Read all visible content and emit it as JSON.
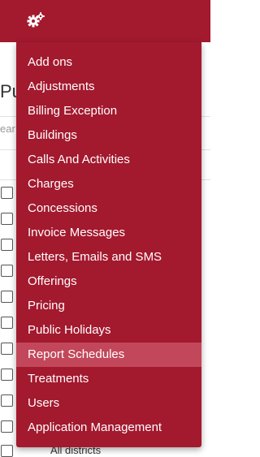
{
  "header": {
    "icon": "gears-icon",
    "background": "#a3192e"
  },
  "background_page": {
    "title": "Pu",
    "search_placeholder": "ear",
    "footer_text": "All districts"
  },
  "menu": {
    "background": "#a3192e",
    "active_background": "#c3475a",
    "items": [
      {
        "label": "Add ons"
      },
      {
        "label": "Adjustments"
      },
      {
        "label": "Billing Exception"
      },
      {
        "label": "Buildings"
      },
      {
        "label": "Calls And Activities"
      },
      {
        "label": "Charges"
      },
      {
        "label": "Concessions"
      },
      {
        "label": "Invoice Messages"
      },
      {
        "label": "Letters, Emails and SMS"
      },
      {
        "label": "Offerings"
      },
      {
        "label": "Pricing"
      },
      {
        "label": "Public Holidays"
      },
      {
        "label": "Report Schedules",
        "active": true
      },
      {
        "label": "Treatments"
      },
      {
        "label": "Users"
      },
      {
        "label": "Application Management"
      }
    ]
  }
}
